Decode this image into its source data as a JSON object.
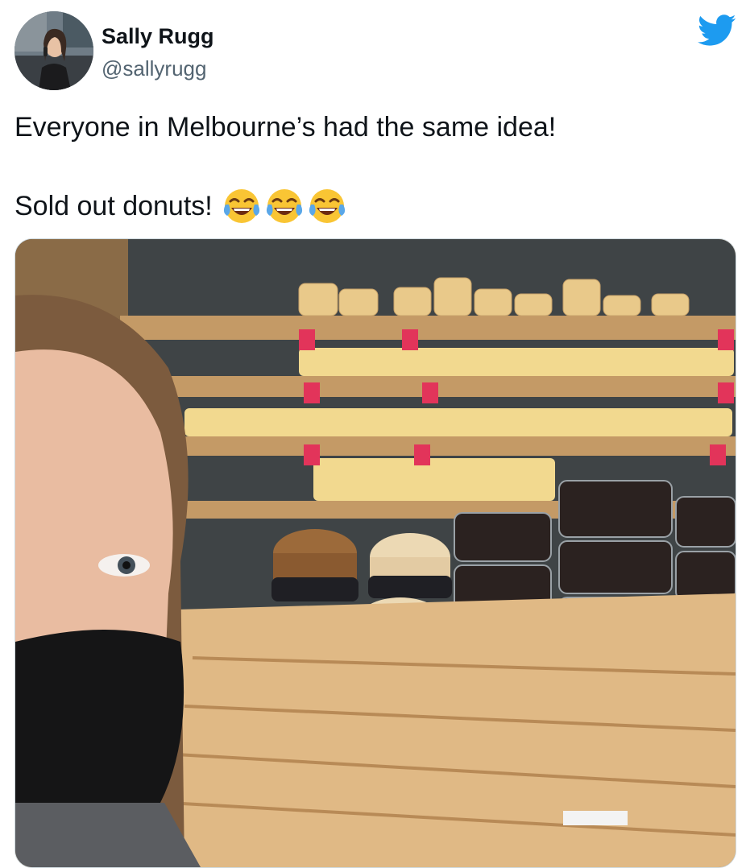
{
  "tweet": {
    "author": {
      "name": "Sally Rugg",
      "handle": "@sallyrugg"
    },
    "text": {
      "line1": "Everyone in Melbourne’s had the same idea!",
      "line2": "Sold out donuts!"
    },
    "emojis": [
      "face-with-tears-of-joy",
      "face-with-tears-of-joy",
      "face-with-tears-of-joy"
    ],
    "brand_color": "#1d9bf0",
    "icons": {
      "platform": "twitter-bird-icon"
    }
  }
}
